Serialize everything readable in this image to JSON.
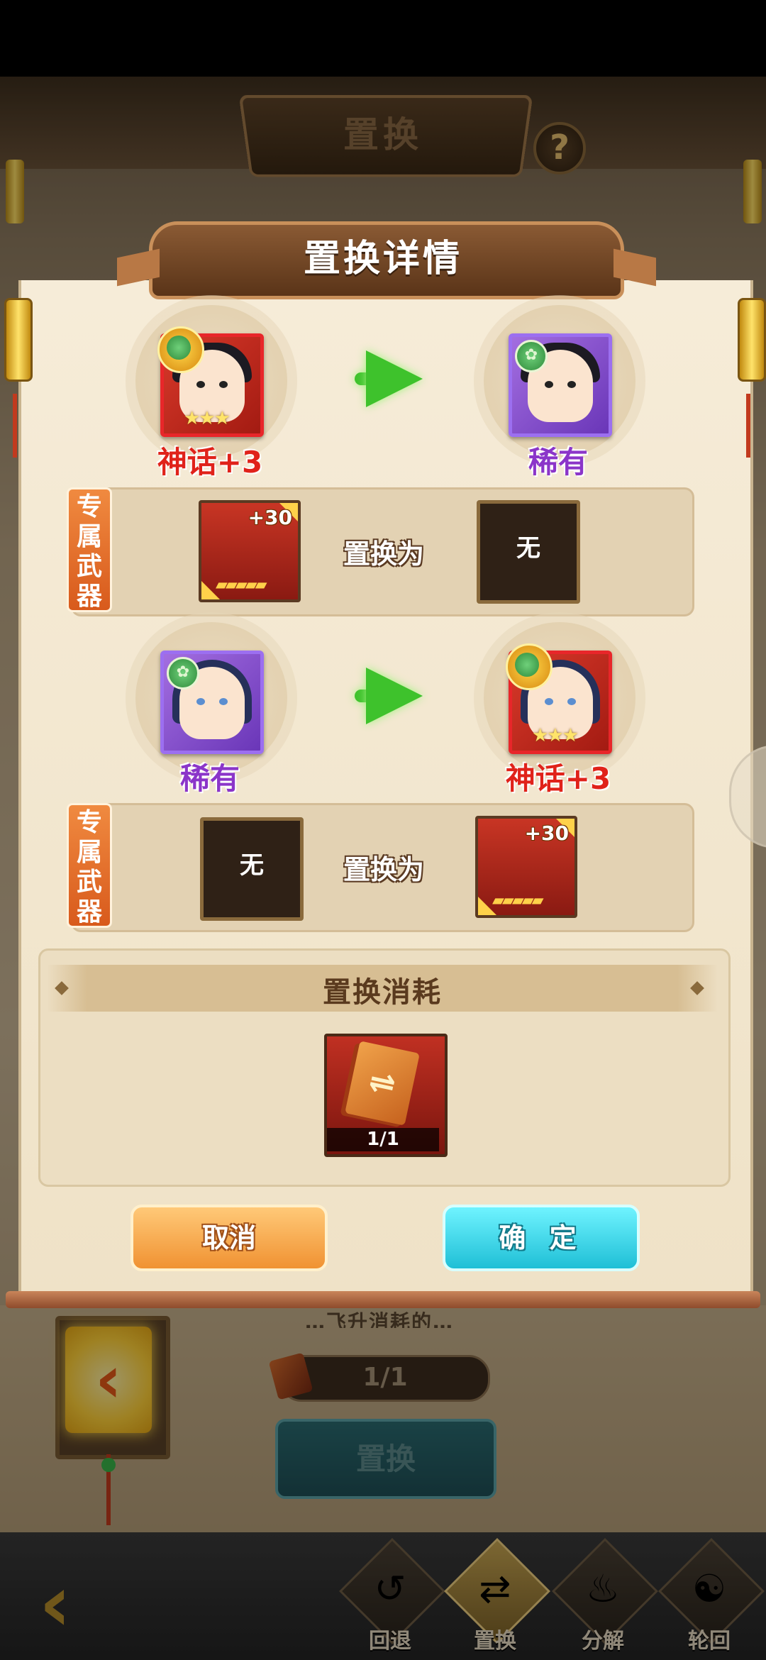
{
  "screen": {
    "title": "置换",
    "help_icon": "question-icon",
    "help_glyph": "?"
  },
  "background": {
    "progress_text": "1/1",
    "replace_button_label": "置换",
    "partial_text": "…飞升消耗的…"
  },
  "bottom_nav": {
    "tabs": [
      {
        "label": "回退",
        "icon": "rewind-icon",
        "glyph": "↺",
        "active": false
      },
      {
        "label": "置换",
        "icon": "swap-icon",
        "glyph": "⇄",
        "active": true
      },
      {
        "label": "分解",
        "icon": "decompose-icon",
        "glyph": "♨",
        "active": false
      },
      {
        "label": "轮回",
        "icon": "reincarnation-icon",
        "glyph": "☯",
        "active": false
      }
    ]
  },
  "modal": {
    "title": "置换详情",
    "swaps": [
      {
        "from": {
          "rarity": "神话+3",
          "stars": "★★★",
          "element_glyph": "✿"
        },
        "to": {
          "rarity": "稀有",
          "element_glyph": "✿"
        },
        "weapon": {
          "tag": "专属武器",
          "from_level": "+30",
          "from_bars": "▰▰▰▰▰",
          "swap_label": "置换为",
          "to_value": "无"
        }
      },
      {
        "from": {
          "rarity": "稀有",
          "element_glyph": "✿"
        },
        "to": {
          "rarity": "神话+3",
          "stars": "★★★",
          "element_glyph": "✿"
        },
        "weapon": {
          "tag": "专属武器",
          "from_value": "无",
          "swap_label": "置换为",
          "to_level": "+30",
          "to_bars": "▰▰▰▰▰"
        }
      }
    ],
    "cost": {
      "title": "置换消耗",
      "item_count": "1/1",
      "item_glyph": "⇌"
    },
    "buttons": {
      "cancel": "取消",
      "confirm": "确 定"
    }
  },
  "colors": {
    "mythic": "#e0221a",
    "rare": "#8b35c9",
    "arrow": "#3ec22c",
    "confirm": "#1fbfd6",
    "cancel": "#f09232"
  }
}
